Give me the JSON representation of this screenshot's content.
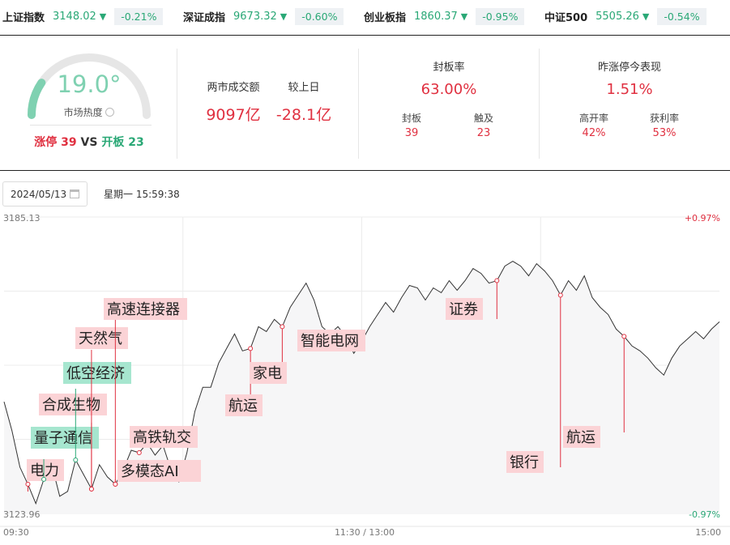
{
  "indices": [
    {
      "name": "上证指数",
      "value": "3148.02",
      "arrow": "▼",
      "change": "-0.21%"
    },
    {
      "name": "深证成指",
      "value": "9673.32",
      "arrow": "▼",
      "change": "-0.60%"
    },
    {
      "name": "创业板指",
      "value": "1860.37",
      "arrow": "▼",
      "change": "-0.95%"
    },
    {
      "name": "中证500",
      "value": "5505.26",
      "arrow": "▼",
      "change": "-0.54%"
    }
  ],
  "heat": {
    "value": "19.0°",
    "label": "市场热度",
    "limit_up_label": "涨停",
    "limit_up": "39",
    "vs": "VS",
    "open_label": "开板",
    "open": "23",
    "level": 0.19
  },
  "turnover": {
    "label": "两市成交额",
    "value": "9097亿",
    "compare_label": "较上日",
    "compare_value": "-28.1亿"
  },
  "seal": {
    "title": "封板率",
    "rate": "63.00%",
    "sealed_label": "封板",
    "sealed": "39",
    "touched_label": "触及",
    "touched": "23"
  },
  "yesterday": {
    "title": "昨涨停今表现",
    "rate": "1.51%",
    "open_high_label": "高开率",
    "open_high": "42%",
    "profit_label": "获利率",
    "profit": "53%"
  },
  "toolbar": {
    "date": "2024/05/13",
    "weekday_time": "星期一 15:59:38"
  },
  "chart_data": {
    "type": "line",
    "ylim": [
      3123.96,
      3185.13
    ],
    "y_labels": {
      "top": "3185.13",
      "bottom": "3123.96"
    },
    "pct_labels": {
      "top": "+0.97%",
      "bottom": "-0.97%"
    },
    "x_labels": [
      "09:30",
      "11:30 / 13:00",
      "15:00"
    ],
    "series": [
      {
        "values": [
          3147.0,
          3141.0,
          3133.5,
          3130.0,
          3126.0,
          3131.0,
          3134.0,
          3127.5,
          3128.5,
          3135.0,
          3132.0,
          3129.0,
          3134.0,
          3131.5,
          3130.0,
          3133.0,
          3137.0,
          3136.5,
          3138.5,
          3136.0,
          3138.0,
          3133.0,
          3130.5,
          3136.5,
          3145.0,
          3150.0,
          3150.0,
          3155.0,
          3158.0,
          3161.0,
          3157.5,
          3158.0,
          3162.5,
          3161.5,
          3164.0,
          3162.5,
          3166.5,
          3169.0,
          3171.5,
          3168.0,
          3162.5,
          3161.0,
          3162.5,
          3160.5,
          3157.0,
          3159.5,
          3162.5,
          3165.0,
          3167.5,
          3165.5,
          3168.5,
          3171.0,
          3170.5,
          3168.0,
          3170.5,
          3169.5,
          3172.0,
          3170.0,
          3172.0,
          3174.5,
          3173.5,
          3171.5,
          3172.0,
          3175.0,
          3176.0,
          3175.0,
          3173.0,
          3175.5,
          3174.0,
          3172.0,
          3169.0,
          3172.0,
          3170.0,
          3173.0,
          3168.5,
          3166.5,
          3165.0,
          3162.0,
          3160.5,
          3158.5,
          3157.5,
          3156.0,
          3154.0,
          3152.5,
          3156.0,
          3158.5,
          3160.0,
          3161.5,
          3160.0,
          3162.0,
          3163.5
        ]
      }
    ],
    "annotations": [
      {
        "label": "电力",
        "index": 3,
        "color": "red"
      },
      {
        "label": "量子通信",
        "index": 5,
        "color": "green"
      },
      {
        "label": "合成生物",
        "index": 11,
        "color": "red"
      },
      {
        "label": "低空经济",
        "index": 9,
        "color": "green"
      },
      {
        "label": "天然气",
        "index": 11,
        "color": "red"
      },
      {
        "label": "高速连接器",
        "index": 14,
        "color": "red"
      },
      {
        "label": "多模态AI",
        "index": 14,
        "color": "red"
      },
      {
        "label": "高铁轨交",
        "index": 17,
        "color": "red"
      },
      {
        "label": "航运",
        "index": 31,
        "color": "red"
      },
      {
        "label": "家电",
        "index": 35,
        "color": "red"
      },
      {
        "label": "智能电网",
        "index": 41,
        "color": "red"
      },
      {
        "label": "证券",
        "index": 62,
        "color": "red"
      },
      {
        "label": "银行",
        "index": 70,
        "color": "red"
      },
      {
        "label": "航运",
        "index": 78,
        "color": "red"
      }
    ]
  }
}
